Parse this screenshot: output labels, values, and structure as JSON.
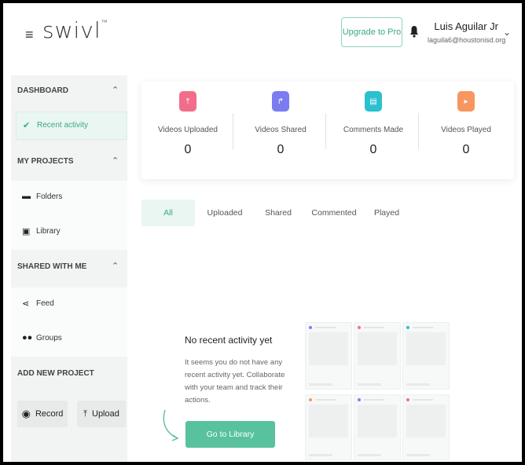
{
  "header": {
    "menu_icon": "hamburger-icon",
    "logo": "swivl",
    "logo_tm": "™",
    "upgrade_label": "Upgrade to Pro",
    "bell_icon": "bell-icon",
    "user_name": "Luis Aguilar Jr",
    "user_email": "laguila6@houstonisd.org",
    "user_menu_icon": "chevron-down-icon"
  },
  "sidebar": {
    "dashboard": {
      "label": "DASHBOARD",
      "items": [
        {
          "label": "Recent activity",
          "icon": "check-icon"
        }
      ]
    },
    "my_projects": {
      "label": "MY PROJECTS",
      "items": [
        {
          "label": "Folders",
          "icon": "folder-icon"
        },
        {
          "label": "Library",
          "icon": "library-icon"
        }
      ]
    },
    "shared_with_me": {
      "label": "SHARED WITH ME",
      "items": [
        {
          "label": "Feed",
          "icon": "share-icon"
        },
        {
          "label": "Groups",
          "icon": "groups-icon"
        }
      ]
    },
    "add_new_project": {
      "label": "ADD NEW PROJECT",
      "record_label": "Record",
      "upload_label": "Upload"
    }
  },
  "stats": [
    {
      "label": "Videos Uploaded",
      "value": "0",
      "color": "#f06e8b",
      "icon": "upload-icon"
    },
    {
      "label": "Videos Shared",
      "value": "0",
      "color": "#7c7cf0",
      "icon": "share-arrow-icon"
    },
    {
      "label": "Comments Made",
      "value": "0",
      "color": "#2bc0cf",
      "icon": "comment-icon"
    },
    {
      "label": "Videos Played",
      "value": "0",
      "color": "#f7975f",
      "icon": "play-icon"
    }
  ],
  "tabs": [
    "All",
    "Uploaded",
    "Shared",
    "Commented",
    "Played"
  ],
  "active_tab": "All",
  "empty_state": {
    "title": "No recent activity yet",
    "description": "It seems you do not have any recent activity yet. Collaborate with your team and track their actions.",
    "button_label": "Go to Library"
  },
  "colors": {
    "accent": "#57c29d",
    "accent_text": "#3aa885",
    "sidebar_bg": "#f2f3f3"
  }
}
